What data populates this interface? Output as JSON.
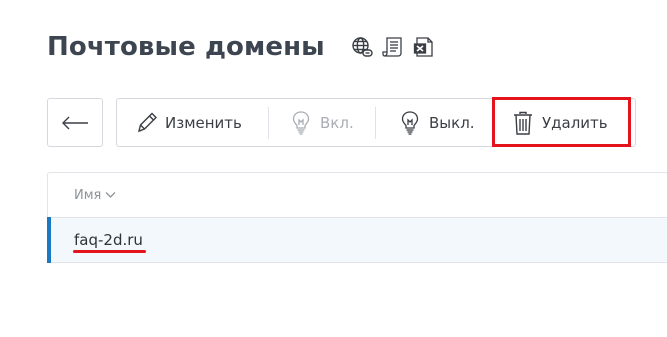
{
  "page": {
    "title": "Почтовые домены"
  },
  "title_icons": [
    "globe-link-icon",
    "list-document-icon",
    "excel-export-icon"
  ],
  "back_button": {
    "icon": "arrow-left-icon"
  },
  "toolbar": {
    "edit": {
      "label": "Изменить",
      "icon": "pencil-icon",
      "enabled": true
    },
    "enable": {
      "label": "Вкл.",
      "icon": "lightbulb-on-icon",
      "enabled": false
    },
    "disable": {
      "label": "Выкл.",
      "icon": "lightbulb-off-icon",
      "enabled": true
    },
    "delete": {
      "label": "Удалить",
      "icon": "trash-icon",
      "enabled": true,
      "highlighted": true
    }
  },
  "table": {
    "columns": [
      {
        "label": "Имя",
        "sort_icon": "chevron-down-icon"
      }
    ],
    "rows": [
      {
        "name": "faq-2d.ru",
        "selected": true
      }
    ]
  },
  "colors": {
    "highlight": "#e3141b",
    "selection_marker": "#1b78c2",
    "selected_row_bg": "#f3f8fc"
  }
}
